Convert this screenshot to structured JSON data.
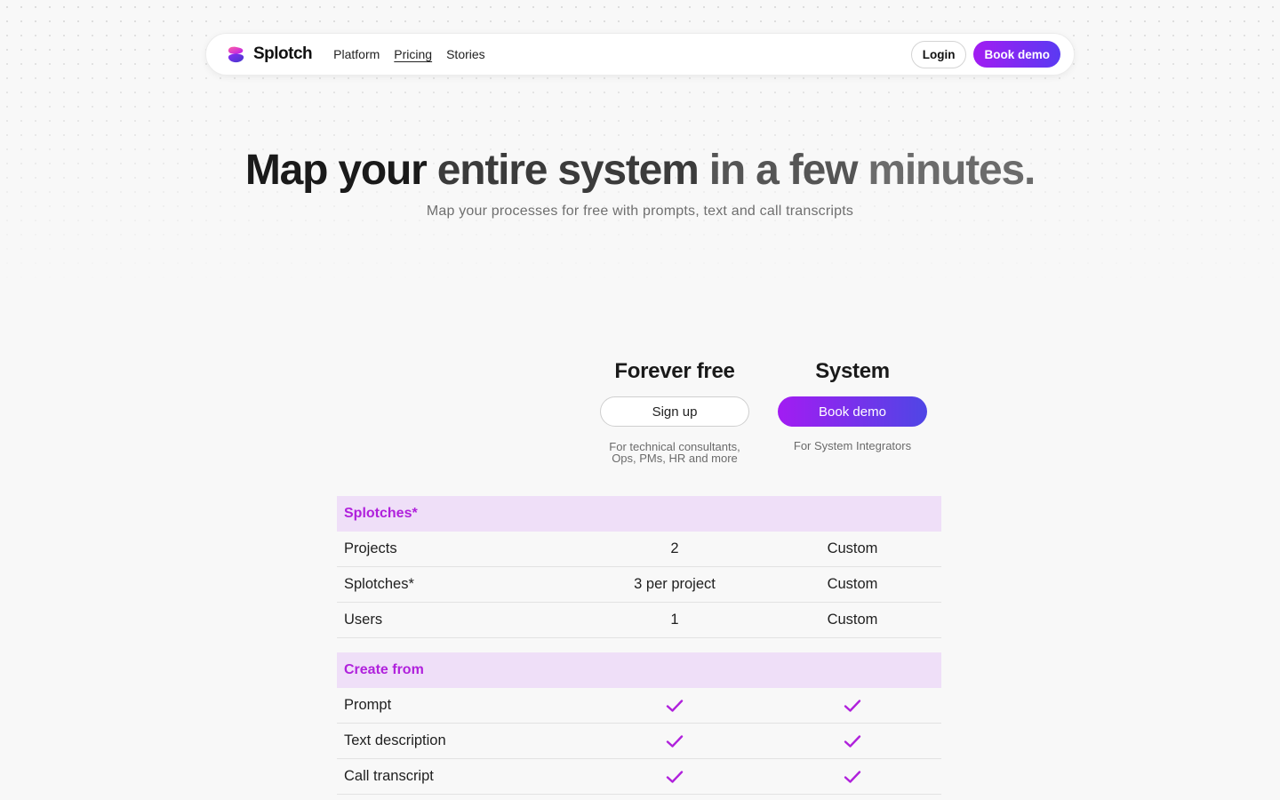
{
  "brand": {
    "name": "Splotch",
    "accent": "#a21cf2",
    "accent_end": "#4f46e5"
  },
  "nav": {
    "links": [
      "Platform",
      "Pricing",
      "Stories"
    ],
    "active": "Pricing",
    "login_label": "Login",
    "demo_label": "Book demo"
  },
  "hero": {
    "title_parts": [
      "Map your",
      "entire system",
      "in a few",
      "minutes."
    ],
    "subtitle": "Map your processes for free with prompts, text and call transcripts"
  },
  "plans": [
    {
      "title": "Forever free",
      "button": "Sign up",
      "desc_lines": [
        "For technical consultants,",
        "Ops, PMs, HR and more"
      ]
    },
    {
      "title": "System",
      "button": "Book demo",
      "desc_lines": [
        "For System Integrators"
      ]
    }
  ],
  "table": {
    "sections": [
      {
        "title": "Splotches*",
        "rows": [
          {
            "label": "Projects",
            "free": "2",
            "system": "Custom"
          },
          {
            "label": "Splotches*",
            "free": "3 per project",
            "system": "Custom"
          },
          {
            "label": "Users",
            "free": "1",
            "system": "Custom"
          }
        ]
      },
      {
        "title": "Create from",
        "rows": [
          {
            "label": "Prompt",
            "free": true,
            "system": true
          },
          {
            "label": "Text description",
            "free": true,
            "system": true
          },
          {
            "label": "Call transcript",
            "free": true,
            "system": true
          }
        ]
      }
    ],
    "check_icon": "checkmark-icon",
    "check_color": "#b021dc"
  }
}
